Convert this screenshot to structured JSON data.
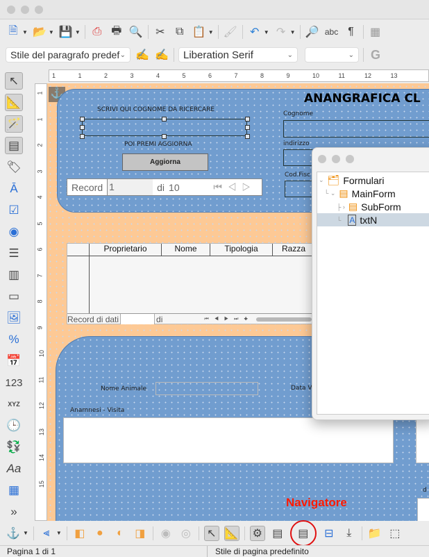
{
  "toolbar2": {
    "paragraph_style": "Stile del paragrafo predef",
    "font_name": "Liberation Serif",
    "font_size": "",
    "bold": "G"
  },
  "ruler": {
    "h_ticks": [
      "1",
      "1",
      "2",
      "3",
      "4",
      "5",
      "6",
      "7",
      "8",
      "9",
      "10",
      "11",
      "12",
      "13"
    ],
    "v_ticks": [
      "1",
      "1",
      "2",
      "3",
      "4",
      "5",
      "6",
      "7",
      "8",
      "9",
      "10",
      "11",
      "12",
      "13",
      "14",
      "15"
    ]
  },
  "form": {
    "title": "ANANGRAFICA CL",
    "search_label": "SCRIVI QUI COGNOME DA RICERCARE",
    "hint": "POI PREMI AGGIORNA",
    "update_button": "Aggiorna",
    "labels": {
      "surname": "Cognome",
      "address": "indirizzo",
      "tax_code": "Cod.Fisc",
      "animal_name": "Nome Animale",
      "visit_date": "Data V",
      "anamnesis": "Anamnesi - Visita",
      "other": "d"
    },
    "record_nav": {
      "label": "Record",
      "value": "1",
      "of": "di",
      "total": "10"
    },
    "grid": {
      "columns": [
        "Proprietario",
        "Nome",
        "Tipologia",
        "Razza"
      ],
      "footer_label": "Record di dati",
      "footer_of": "di"
    }
  },
  "navigator": {
    "items": [
      {
        "label": "Formulari",
        "icon": "forms-icon"
      },
      {
        "label": "MainForm",
        "icon": "form-icon"
      },
      {
        "label": "SubForm",
        "icon": "form-icon"
      },
      {
        "label": "txtN",
        "icon": "textbox-icon",
        "selected": true
      }
    ]
  },
  "annotation": {
    "text": "Navigatore",
    "color": "#ff1a00"
  },
  "status": {
    "page": "Pagina 1 di 1",
    "page_style": "Stile di pagina predefinito"
  },
  "colors": {
    "form_blue": "#719dcf",
    "page_orange": "#fdc995"
  }
}
